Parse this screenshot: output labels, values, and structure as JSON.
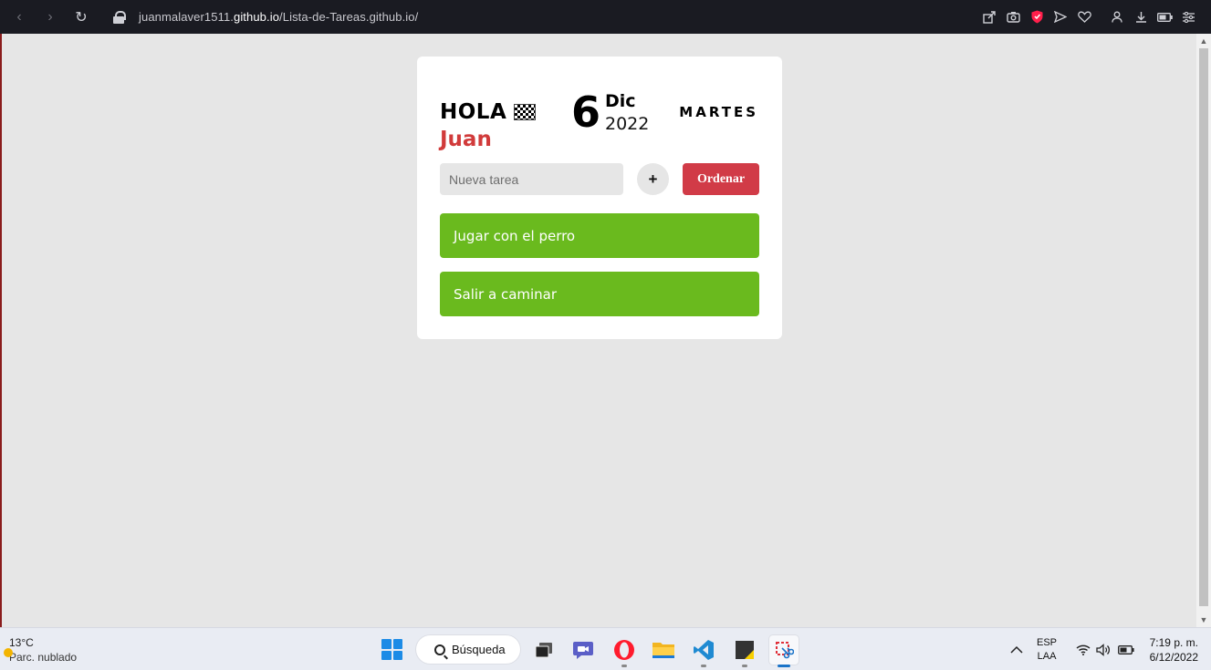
{
  "browser": {
    "url_prefix": "juanmalaver1511.",
    "url_domain": "github.io",
    "url_path": "/Lista-de-Tareas.github.io/",
    "nav": {
      "back": "‹",
      "forward": "›",
      "reload": "↻"
    },
    "icons": [
      "share-icon",
      "camera-icon",
      "shield-icon",
      "send-icon",
      "heart-icon",
      "profile-icon",
      "download-icon",
      "battery-icon",
      "menu-icon"
    ]
  },
  "app": {
    "greeting": "HOLA",
    "name": "Juan",
    "day": "6",
    "month": "Dic",
    "year": "2022",
    "weekday": "MARTES",
    "input_placeholder": "Nueva tarea",
    "add_label": "+",
    "sort_label": "Ordenar",
    "tasks": [
      {
        "label": "Jugar con el perro"
      },
      {
        "label": "Salir a caminar"
      }
    ],
    "colors": {
      "accent": "#d13b47",
      "name": "#d13b3b",
      "task": "#6aba1e",
      "card": "#ffffff",
      "background": "#e6e6e6"
    }
  },
  "taskbar": {
    "temperature": "13°C",
    "weather": "Parc. nublado",
    "search_label": "Búsqueda",
    "lang_top": "ESP",
    "lang_bottom": "LAA",
    "time": "7:19 p. m.",
    "date": "6/12/2022"
  }
}
